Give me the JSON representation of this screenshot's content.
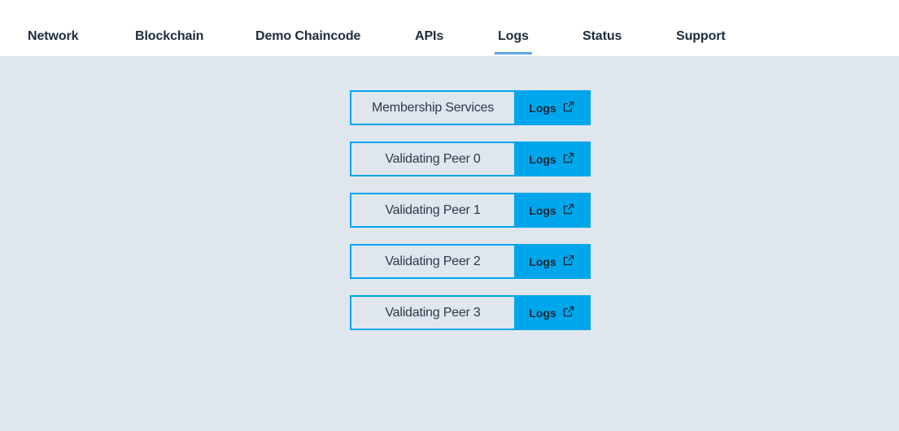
{
  "nav": {
    "tabs": [
      {
        "label": "Network",
        "active": false
      },
      {
        "label": "Blockchain",
        "active": false
      },
      {
        "label": "Demo Chaincode",
        "active": false
      },
      {
        "label": "APIs",
        "active": false
      },
      {
        "label": "Logs",
        "active": true
      },
      {
        "label": "Status",
        "active": false
      },
      {
        "label": "Support",
        "active": false
      }
    ]
  },
  "logs": {
    "items": [
      {
        "name": "Membership Services",
        "button_label": "Logs",
        "icon": "external-link-icon"
      },
      {
        "name": "Validating Peer 0",
        "button_label": "Logs",
        "icon": "external-link-icon"
      },
      {
        "name": "Validating Peer 1",
        "button_label": "Logs",
        "icon": "external-link-icon"
      },
      {
        "name": "Validating Peer 2",
        "button_label": "Logs",
        "icon": "external-link-icon"
      },
      {
        "name": "Validating Peer 3",
        "button_label": "Logs",
        "icon": "external-link-icon"
      }
    ]
  },
  "colors": {
    "accent": "#00a6ec",
    "active_underline": "#5ba7e3",
    "background": "#dfe6ee",
    "text": "#1d2c3a"
  }
}
